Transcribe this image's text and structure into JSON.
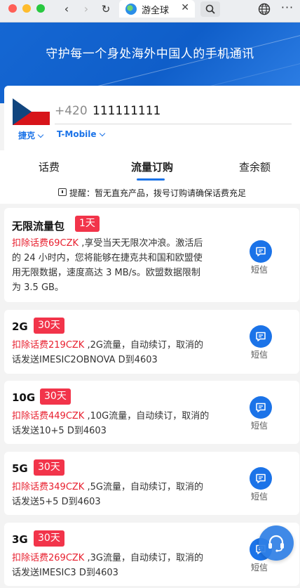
{
  "browser": {
    "tab_title": "游全球",
    "tab_close": "✕",
    "back_glyph": "‹",
    "forward_glyph": "›",
    "reload_glyph": "↻",
    "more_glyph": "···"
  },
  "banner": {
    "title": "守护每一个身处海外中国人的手机通讯"
  },
  "phone": {
    "country_code": "+420",
    "number": "111111111",
    "country": "捷克",
    "carrier": "T-Mobile"
  },
  "tabs": [
    {
      "label": "话费"
    },
    {
      "label": "流量订购",
      "active": true
    },
    {
      "label": "查余额"
    }
  ],
  "notice": {
    "text": "提醒：暂无直充产品，拨号订购请确保话费充足"
  },
  "products": [
    {
      "name": "无限流量包",
      "duration": "1天",
      "price_text": "扣除话费69CZK",
      "desc_line1": " ,享受当天无限次冲浪。激活后",
      "desc_line2": "的 24 小时内，您将能够在捷克共和国和欧盟使",
      "desc_line3": "用无限数据，速度高达 3 MB/s。欧盟数据限制",
      "desc_line4": "为 3.5 GB。",
      "action_label": "短信"
    },
    {
      "name": "2G",
      "duration": "30天",
      "price_text": "扣除话费219CZK",
      "desc_line1": " ,2G流量，自动续订，取消的",
      "desc_line2": "话发送IMESIC2OBNOVA D到4603",
      "action_label": "短信"
    },
    {
      "name": "10G",
      "duration": "30天",
      "price_text": "扣除话费449CZK",
      "desc_line1": " ,10G流量，自动续订，取消的",
      "desc_line2": "话发送10+5 D到4603",
      "action_label": "短信"
    },
    {
      "name": "5G",
      "duration": "30天",
      "price_text": "扣除话费349CZK",
      "desc_line1": " ,5G流量，自动续订，取消的",
      "desc_line2": "话发送5+5 D到4603",
      "action_label": "短信"
    },
    {
      "name": "3G",
      "duration": "30天",
      "price_text": "扣除话费269CZK",
      "desc_line1": " ,3G流量，自动续订，取消的",
      "desc_line2": "话发送IMESIC3 D到4603",
      "action_label": "短信"
    }
  ],
  "colors": {
    "brand_blue": "#1b73e8",
    "badge_red": "#f2344a",
    "price_red": "#e8202f"
  }
}
